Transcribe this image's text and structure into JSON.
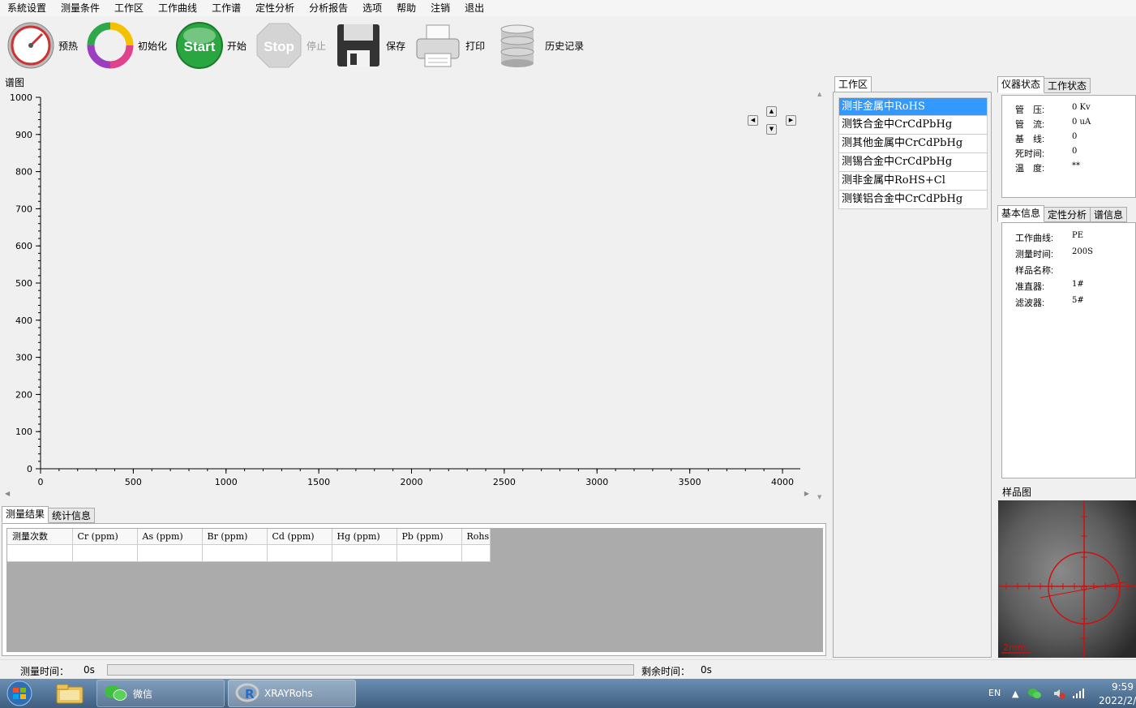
{
  "menu": [
    "系統设置",
    "测量条件",
    "工作区",
    "工作曲线",
    "工作谱",
    "定性分析",
    "分析报告",
    "选项",
    "帮助",
    "注销",
    "退出"
  ],
  "toolbar": {
    "preheat": "预热",
    "init": "初始化",
    "start": "开始",
    "start_badge": "Start",
    "stop": "停止",
    "stop_badge": "Stop",
    "save": "保存",
    "print": "打印",
    "history": "历史记录"
  },
  "spectrum": {
    "title": "谱图",
    "x_ticks": [
      "0",
      "500",
      "1000",
      "1500",
      "2000",
      "2500",
      "3000",
      "3500",
      "4000"
    ],
    "y_ticks": [
      "0",
      "100",
      "200",
      "300",
      "400",
      "500",
      "600",
      "700",
      "800",
      "900",
      "1000"
    ]
  },
  "chart_data": {
    "type": "line",
    "xlim": [
      0,
      4096
    ],
    "ylim": [
      0,
      1000
    ],
    "x_ticks": [
      0,
      500,
      1000,
      1500,
      2000,
      2500,
      3000,
      3500,
      4000
    ],
    "y_ticks": [
      0,
      100,
      200,
      300,
      400,
      500,
      600,
      700,
      800,
      900,
      1000
    ],
    "series": [],
    "grid": false
  },
  "results": {
    "tabs": [
      "测量结果",
      "统计信息"
    ],
    "columns": [
      "测量次数",
      "Cr (ppm)",
      "As (ppm)",
      "Br (ppm)",
      "Cd (ppm)",
      "Hg (ppm)",
      "Pb (ppm)",
      "Rohs"
    ]
  },
  "workspace": {
    "tab": "工作区",
    "items": [
      "测非金属中RoHS",
      "测铁合金中CrCdPbHg",
      "测其他金属中CrCdPbHg",
      "测锡合金中CrCdPbHg",
      "测非金属中RoHS+Cl",
      "测镁铝合金中CrCdPbHg"
    ]
  },
  "instrument": {
    "tabs": [
      "仪器状态",
      "工作状态"
    ],
    "rows": [
      {
        "k": "管　压:",
        "v": "0 Kv"
      },
      {
        "k": "管　流:",
        "v": "0 uA"
      },
      {
        "k": "基　线:",
        "v": "0"
      },
      {
        "k": "死时间:",
        "v": "0"
      },
      {
        "k": "温　度:",
        "v": "**"
      }
    ]
  },
  "basic": {
    "tabs": [
      "基本信息",
      "定性分析",
      "谱信息"
    ],
    "rows": [
      {
        "k": "工作曲线:",
        "v": "PE"
      },
      {
        "k": "测量时间:",
        "v": "200S"
      },
      {
        "k": "样品名称:",
        "v": ""
      },
      {
        "k": "准直器:",
        "v": "1#"
      },
      {
        "k": "滤波器:",
        "v": "5#"
      }
    ]
  },
  "sample": {
    "title": "样品图",
    "scale_label": "2mm"
  },
  "status": {
    "measure_label": "测量时间：",
    "measure_value": "0s",
    "remain_label": "剩余时间：",
    "remain_value": "0s"
  },
  "taskbar": {
    "wechat": "微信",
    "app": "XRAYRohs",
    "lang": "EN",
    "time": "9:59",
    "date": "2022/2/"
  }
}
